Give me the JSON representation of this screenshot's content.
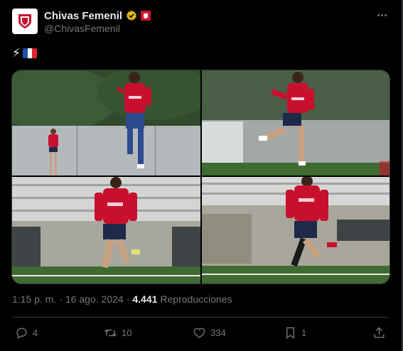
{
  "author": {
    "display_name": "Chivas Femenil",
    "handle": "@ChivasFemenil",
    "verified_badge_color": "#e2b719",
    "club_badge_color": "#d4142e"
  },
  "post": {
    "text_emojis": [
      "⚡"
    ],
    "flag": "france-flag",
    "images": [
      {
        "name": "photo-1"
      },
      {
        "name": "photo-2"
      },
      {
        "name": "photo-3"
      },
      {
        "name": "photo-4"
      }
    ],
    "time": "1:15 p. m.",
    "separator": "·",
    "date": "16 ago. 2024",
    "view_count": "4.441",
    "views_label": "Reproducciones"
  },
  "actions": {
    "replies": "4",
    "reposts": "10",
    "likes": "334",
    "bookmarks": "1"
  },
  "colors": {
    "background": "#000000",
    "text_primary": "#e7e9ea",
    "text_secondary": "#71767b",
    "border": "#2f3336",
    "kit_red": "#c8102e",
    "kit_navy": "#1f2a4a"
  }
}
